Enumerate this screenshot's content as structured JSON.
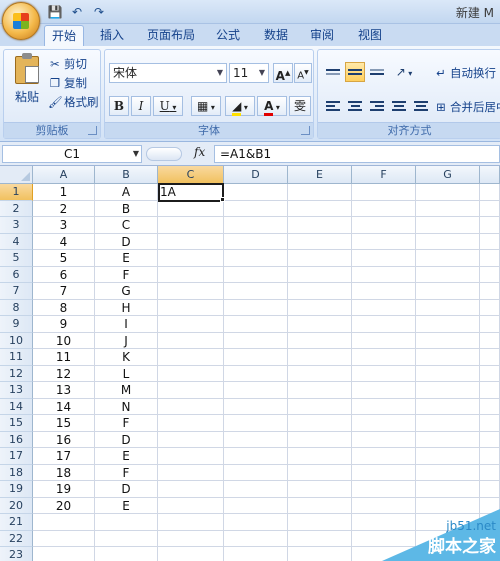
{
  "window": {
    "title": "新建 M"
  },
  "qat": {
    "icons": [
      "save-icon",
      "undo-icon",
      "redo-icon"
    ]
  },
  "tabs": [
    {
      "label": "开始",
      "active": true
    },
    {
      "label": "插入"
    },
    {
      "label": "页面布局"
    },
    {
      "label": "公式"
    },
    {
      "label": "数据"
    },
    {
      "label": "审阅"
    },
    {
      "label": "视图"
    }
  ],
  "ribbon": {
    "clipboard": {
      "group_label": "剪贴板",
      "paste_label": "粘贴",
      "cut_label": "剪切",
      "copy_label": "复制",
      "format_painter_label": "格式刷"
    },
    "font": {
      "group_label": "字体",
      "font_name": "宋体",
      "font_size": "11",
      "bold": "B",
      "italic": "I",
      "underline": "U",
      "grow": "A",
      "shrink": "A",
      "font_color": "A",
      "phonetic": "雯"
    },
    "alignment": {
      "group_label": "对齐方式",
      "wrap_text_label": "自动换行",
      "merge_label": "合并后居中"
    }
  },
  "formula_bar": {
    "name_box": "C1",
    "fx": "fx",
    "formula": "=A1&B1"
  },
  "sheet": {
    "columns": [
      "A",
      "B",
      "C",
      "D",
      "E",
      "F",
      "G"
    ],
    "active_column": "C",
    "active_row": 1,
    "rows": [
      {
        "n": "1",
        "a": "1",
        "b": "A",
        "c": "1A"
      },
      {
        "n": "2",
        "a": "2",
        "b": "B",
        "c": ""
      },
      {
        "n": "3",
        "a": "3",
        "b": "C",
        "c": ""
      },
      {
        "n": "4",
        "a": "4",
        "b": "D",
        "c": ""
      },
      {
        "n": "5",
        "a": "5",
        "b": "E",
        "c": ""
      },
      {
        "n": "6",
        "a": "6",
        "b": "F",
        "c": ""
      },
      {
        "n": "7",
        "a": "7",
        "b": "G",
        "c": ""
      },
      {
        "n": "8",
        "a": "8",
        "b": "H",
        "c": ""
      },
      {
        "n": "9",
        "a": "9",
        "b": "I",
        "c": ""
      },
      {
        "n": "10",
        "a": "10",
        "b": "J",
        "c": ""
      },
      {
        "n": "11",
        "a": "11",
        "b": "K",
        "c": ""
      },
      {
        "n": "12",
        "a": "12",
        "b": "L",
        "c": ""
      },
      {
        "n": "13",
        "a": "13",
        "b": "M",
        "c": ""
      },
      {
        "n": "14",
        "a": "14",
        "b": "N",
        "c": ""
      },
      {
        "n": "15",
        "a": "15",
        "b": "F",
        "c": ""
      },
      {
        "n": "16",
        "a": "16",
        "b": "D",
        "c": ""
      },
      {
        "n": "17",
        "a": "17",
        "b": "E",
        "c": ""
      },
      {
        "n": "18",
        "a": "18",
        "b": "F",
        "c": ""
      },
      {
        "n": "19",
        "a": "19",
        "b": "D",
        "c": ""
      },
      {
        "n": "20",
        "a": "20",
        "b": "E",
        "c": ""
      },
      {
        "n": "21",
        "a": "",
        "b": "",
        "c": ""
      },
      {
        "n": "22",
        "a": "",
        "b": "",
        "c": ""
      },
      {
        "n": "23",
        "a": "",
        "b": "",
        "c": ""
      }
    ]
  },
  "watermark": {
    "site": "jb51.net",
    "name": "脚本之家"
  },
  "colors": {
    "selection_header": "#f1c15f",
    "ribbon_text": "#15428b",
    "watermark_blue": "#5db8e6"
  }
}
